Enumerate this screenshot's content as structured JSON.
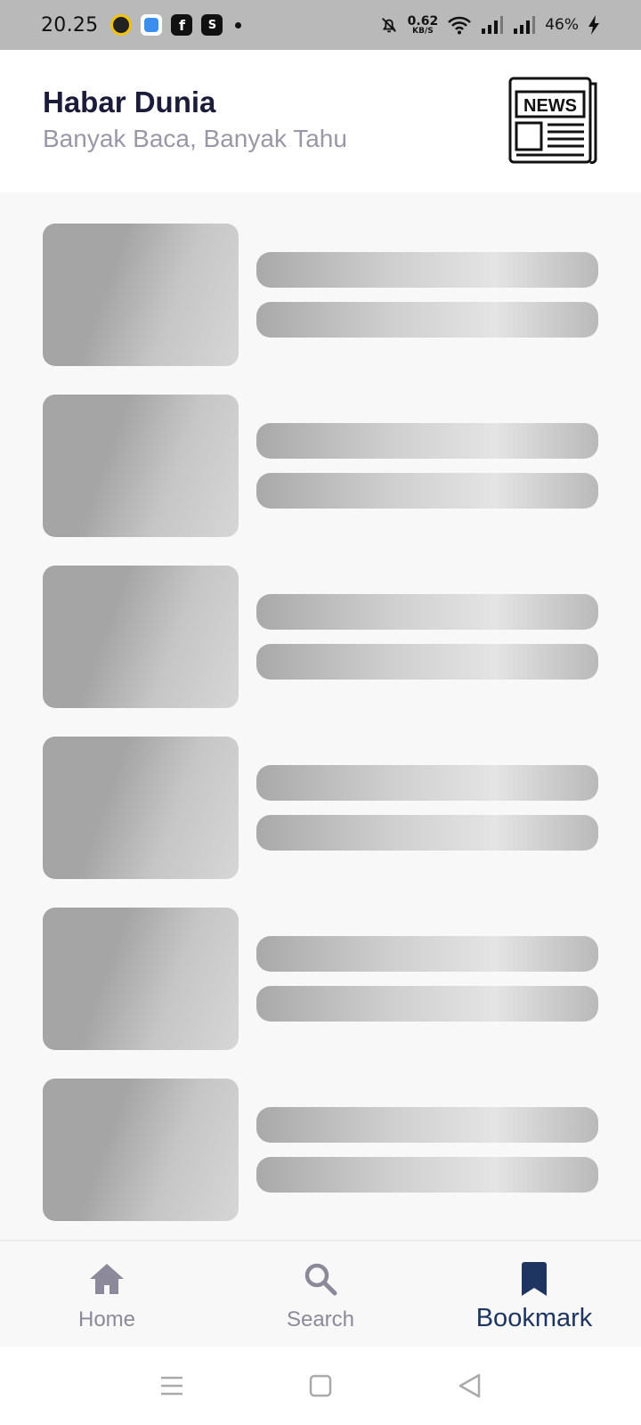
{
  "status_bar": {
    "time": "20.25",
    "net_speed_value": "0.62",
    "net_speed_unit": "KB/S",
    "battery": "46%"
  },
  "header": {
    "title": "Habar Dunia",
    "subtitle": "Banyak Baca, Banyak Tahu",
    "logo_text": "NEWS"
  },
  "list": {
    "loading_items": 6,
    "state": "loading-skeleton"
  },
  "bottom_nav": {
    "items": [
      {
        "label": "Home",
        "icon": "home-icon",
        "active": false
      },
      {
        "label": "Search",
        "icon": "search-icon",
        "active": false
      },
      {
        "label": "Bookmark",
        "icon": "bookmark-icon",
        "active": true
      }
    ]
  },
  "colors": {
    "title": "#1b1b3a",
    "subtitle": "#9a98a6",
    "nav_inactive": "#8c8a9a",
    "nav_active": "#1d3560",
    "skeleton": "#a5a5a5"
  }
}
